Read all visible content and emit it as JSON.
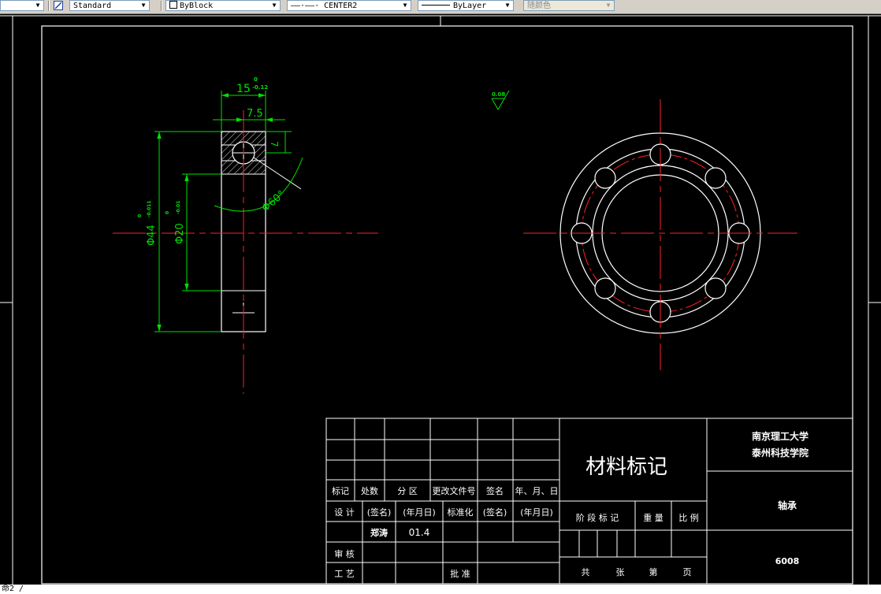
{
  "toolbar": {
    "text_style": "Standard",
    "color": "ByBlock",
    "linetype": "CENTER2",
    "linetype_preview": "——·——·",
    "lineweight": "ByLayer",
    "plot_style": "随颜色"
  },
  "drawing": {
    "dims": {
      "width_15": "15",
      "width_15_tol_upper": "0",
      "width_15_tol_lower": "-0.12",
      "half_width": "7.5",
      "depth_7": "7",
      "angle_60": "Φ60°",
      "dia_44": "Φ44",
      "dia_44_tol_upper": "0",
      "dia_44_tol_lower": "-0.011",
      "dia_20": "Φ20",
      "dia_20_tol_upper": "0",
      "dia_20_tol_lower": "-0.01",
      "roughness": "0.08"
    },
    "colors": {
      "outline": "#ffffff",
      "centerline": "#ff2020",
      "dimension": "#00e000",
      "hatch": "#ffffff"
    }
  },
  "title_block": {
    "material": "材料标记",
    "school_line1": "南京理工大学",
    "school_line2": "泰州科技学院",
    "part_name": "轴承",
    "part_code": "6008",
    "header_mark": "标记",
    "header_count": "处数",
    "header_zone": "分 区",
    "header_docno": "更改文件号",
    "header_sign": "签名",
    "header_date": "年、月、日",
    "design": "设 计",
    "sign_paren": "(签名)",
    "date_paren": "(年月日)",
    "standard": "标准化",
    "sign_paren2": "(签名)",
    "date_paren2": "(年月日)",
    "designer": "郑涛",
    "design_date": "01.4",
    "review": "审 核",
    "process": "工 艺",
    "approve": "批 准",
    "stage_mark": "阶 段 标 记",
    "weight": "重 量",
    "scale": "比 例",
    "total": "共",
    "sheets": "张",
    "sheet_no": "第",
    "page": "页"
  },
  "command_line": "命2 /"
}
